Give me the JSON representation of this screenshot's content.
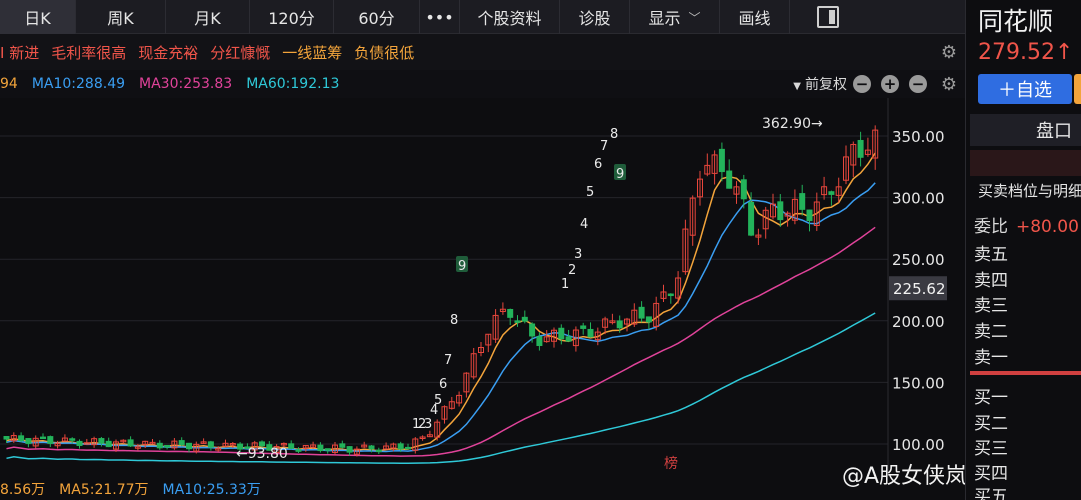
{
  "tabs": [
    {
      "label": "日K",
      "active": true
    },
    {
      "label": "周K"
    },
    {
      "label": "月K"
    },
    {
      "label": "120分"
    },
    {
      "label": "60分"
    },
    {
      "label": "•••"
    },
    {
      "label": "个股资料"
    },
    {
      "label": "诊股"
    },
    {
      "label": "显示"
    },
    {
      "label": "画线"
    }
  ],
  "tags": [
    {
      "label": "I 新进",
      "color": "red"
    },
    {
      "label": "毛利率很高",
      "color": "red"
    },
    {
      "label": "现金充裕",
      "color": "red"
    },
    {
      "label": "分红慷慨",
      "color": "red"
    },
    {
      "label": "一线蓝筹",
      "color": "orange"
    },
    {
      "label": "负债很低",
      "color": "orange"
    }
  ],
  "ma": {
    "ma5_partial": "94",
    "ma10": "MA10:288.49",
    "ma30": "MA30:253.83",
    "ma60": "MA60:192.13",
    "adjust": "前复权",
    "colors": {
      "ma5": "#f3a43b",
      "ma10": "#3a9ef2",
      "ma30": "#e0439a",
      "ma60": "#2fc9d8"
    }
  },
  "chart_data": {
    "type": "candlestick",
    "y_ticks": [
      "350.00",
      "300.00",
      "250.00",
      "200.00",
      "150.00",
      "100.00"
    ],
    "ylim": [
      95,
      370
    ],
    "current_price_label": "225.62",
    "max_label": "362.90→",
    "min_label": "←93.80",
    "markers": [
      "1",
      "2",
      "3",
      "4",
      "5",
      "6",
      "7",
      "8",
      "9",
      "1",
      "2",
      "3",
      "4",
      "5",
      "6",
      "7",
      "8",
      "9"
    ],
    "board_badge": "榜"
  },
  "volume": {
    "partial": "8.56万",
    "ma5": "MA5:21.77万",
    "ma10": "MA10:25.33万"
  },
  "panel": {
    "name": "同花顺",
    "price": "279.52↑",
    "add_label": "＋自选",
    "pankou": "盘口",
    "detail": "买卖档位与明细",
    "weibi_label": "委比",
    "weibi_value": "+80.00",
    "sell": [
      "卖五",
      "卖四",
      "卖三",
      "卖二",
      "卖一"
    ],
    "buy": [
      "买一",
      "买二",
      "买三",
      "买四",
      "买五"
    ]
  },
  "watermark": "@A股女侠岚岚"
}
